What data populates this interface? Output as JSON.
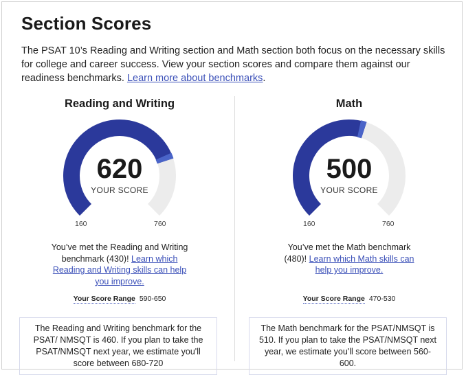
{
  "title": "Section Scores",
  "intro": {
    "text": "The PSAT 10’s Reading and Writing section and Math section both focus on the necessary skills for college and career success. View your section scores and compare them against our readiness benchmarks. ",
    "link": "Learn more about benchmarks",
    "after": "."
  },
  "colors": {
    "accent": "#2b399b",
    "marker": "#4a64c8",
    "track": "#ececec",
    "link": "#3a4fb8"
  },
  "sections": [
    {
      "heading": "Reading and Writing",
      "score": "620",
      "score_value": 620,
      "score_label": "YOUR SCORE",
      "min": "160",
      "max": "760",
      "min_value": 160,
      "max_value": 760,
      "message": "You’ve met the Reading and Writing benchmark (430)! ",
      "message_link": "Learn which Reading and Writing skills can help you improve.",
      "range_label": "Your Score Range",
      "range_value": "590-650",
      "benchmark_text": "The Reading and Writing benchmark for the PSAT/ NMSQT is 460. If you plan to take the PSAT/NMSQT next year, we estimate you'll score between 680-720"
    },
    {
      "heading": "Math",
      "score": "500",
      "score_value": 500,
      "score_label": "YOUR SCORE",
      "min": "160",
      "max": "760",
      "min_value": 160,
      "max_value": 760,
      "message": "You’ve met the Math benchmark (480)! ",
      "message_link": "Learn which Math skills can help you improve.",
      "range_label": "Your Score Range",
      "range_value": "470-530",
      "benchmark_text": "The Math benchmark for the PSAT/NMSQT is 510. If you plan to take the PSAT/NMSQT next year, we estimate you'll score between 560-600."
    }
  ]
}
